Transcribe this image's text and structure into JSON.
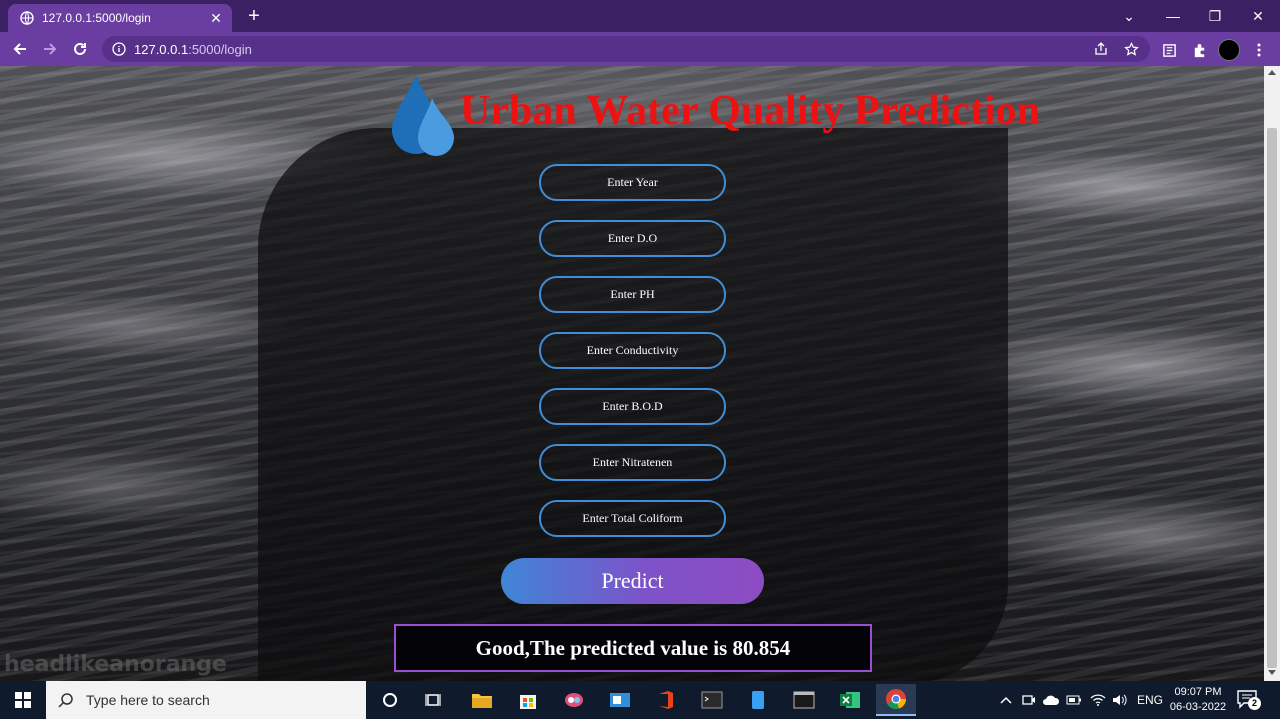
{
  "browser": {
    "tab_title": "127.0.0.1:5000/login",
    "tab_close": "✕",
    "new_tab": "+",
    "url_host": "127.0.0.1",
    "url_path": ":5000/login",
    "window_controls": [
      "⌄",
      "—",
      "❐",
      "✕"
    ]
  },
  "page": {
    "heading": "Urban Water Quality Prediction",
    "fields": [
      {
        "placeholder": "Enter Year"
      },
      {
        "placeholder": "Enter D.O"
      },
      {
        "placeholder": "Enter PH"
      },
      {
        "placeholder": "Enter Conductivity"
      },
      {
        "placeholder": "Enter B.O.D"
      },
      {
        "placeholder": "Enter Nitratenen"
      },
      {
        "placeholder": "Enter Total Coliform"
      }
    ],
    "predict_label": "Predict",
    "result_text": "Good,The predicted value is 80.854",
    "watermark": "headlikeanorange"
  },
  "taskbar": {
    "search_placeholder": "Type here to search",
    "language": "ENG",
    "time": "09:07 PM",
    "date": "06-03-2022",
    "notification_count": "2"
  },
  "colors": {
    "heading": "#ee1111",
    "field_border": "#3f8ed6",
    "result_border": "#9b4fd1",
    "browser_frame": "#6a3ea1"
  }
}
